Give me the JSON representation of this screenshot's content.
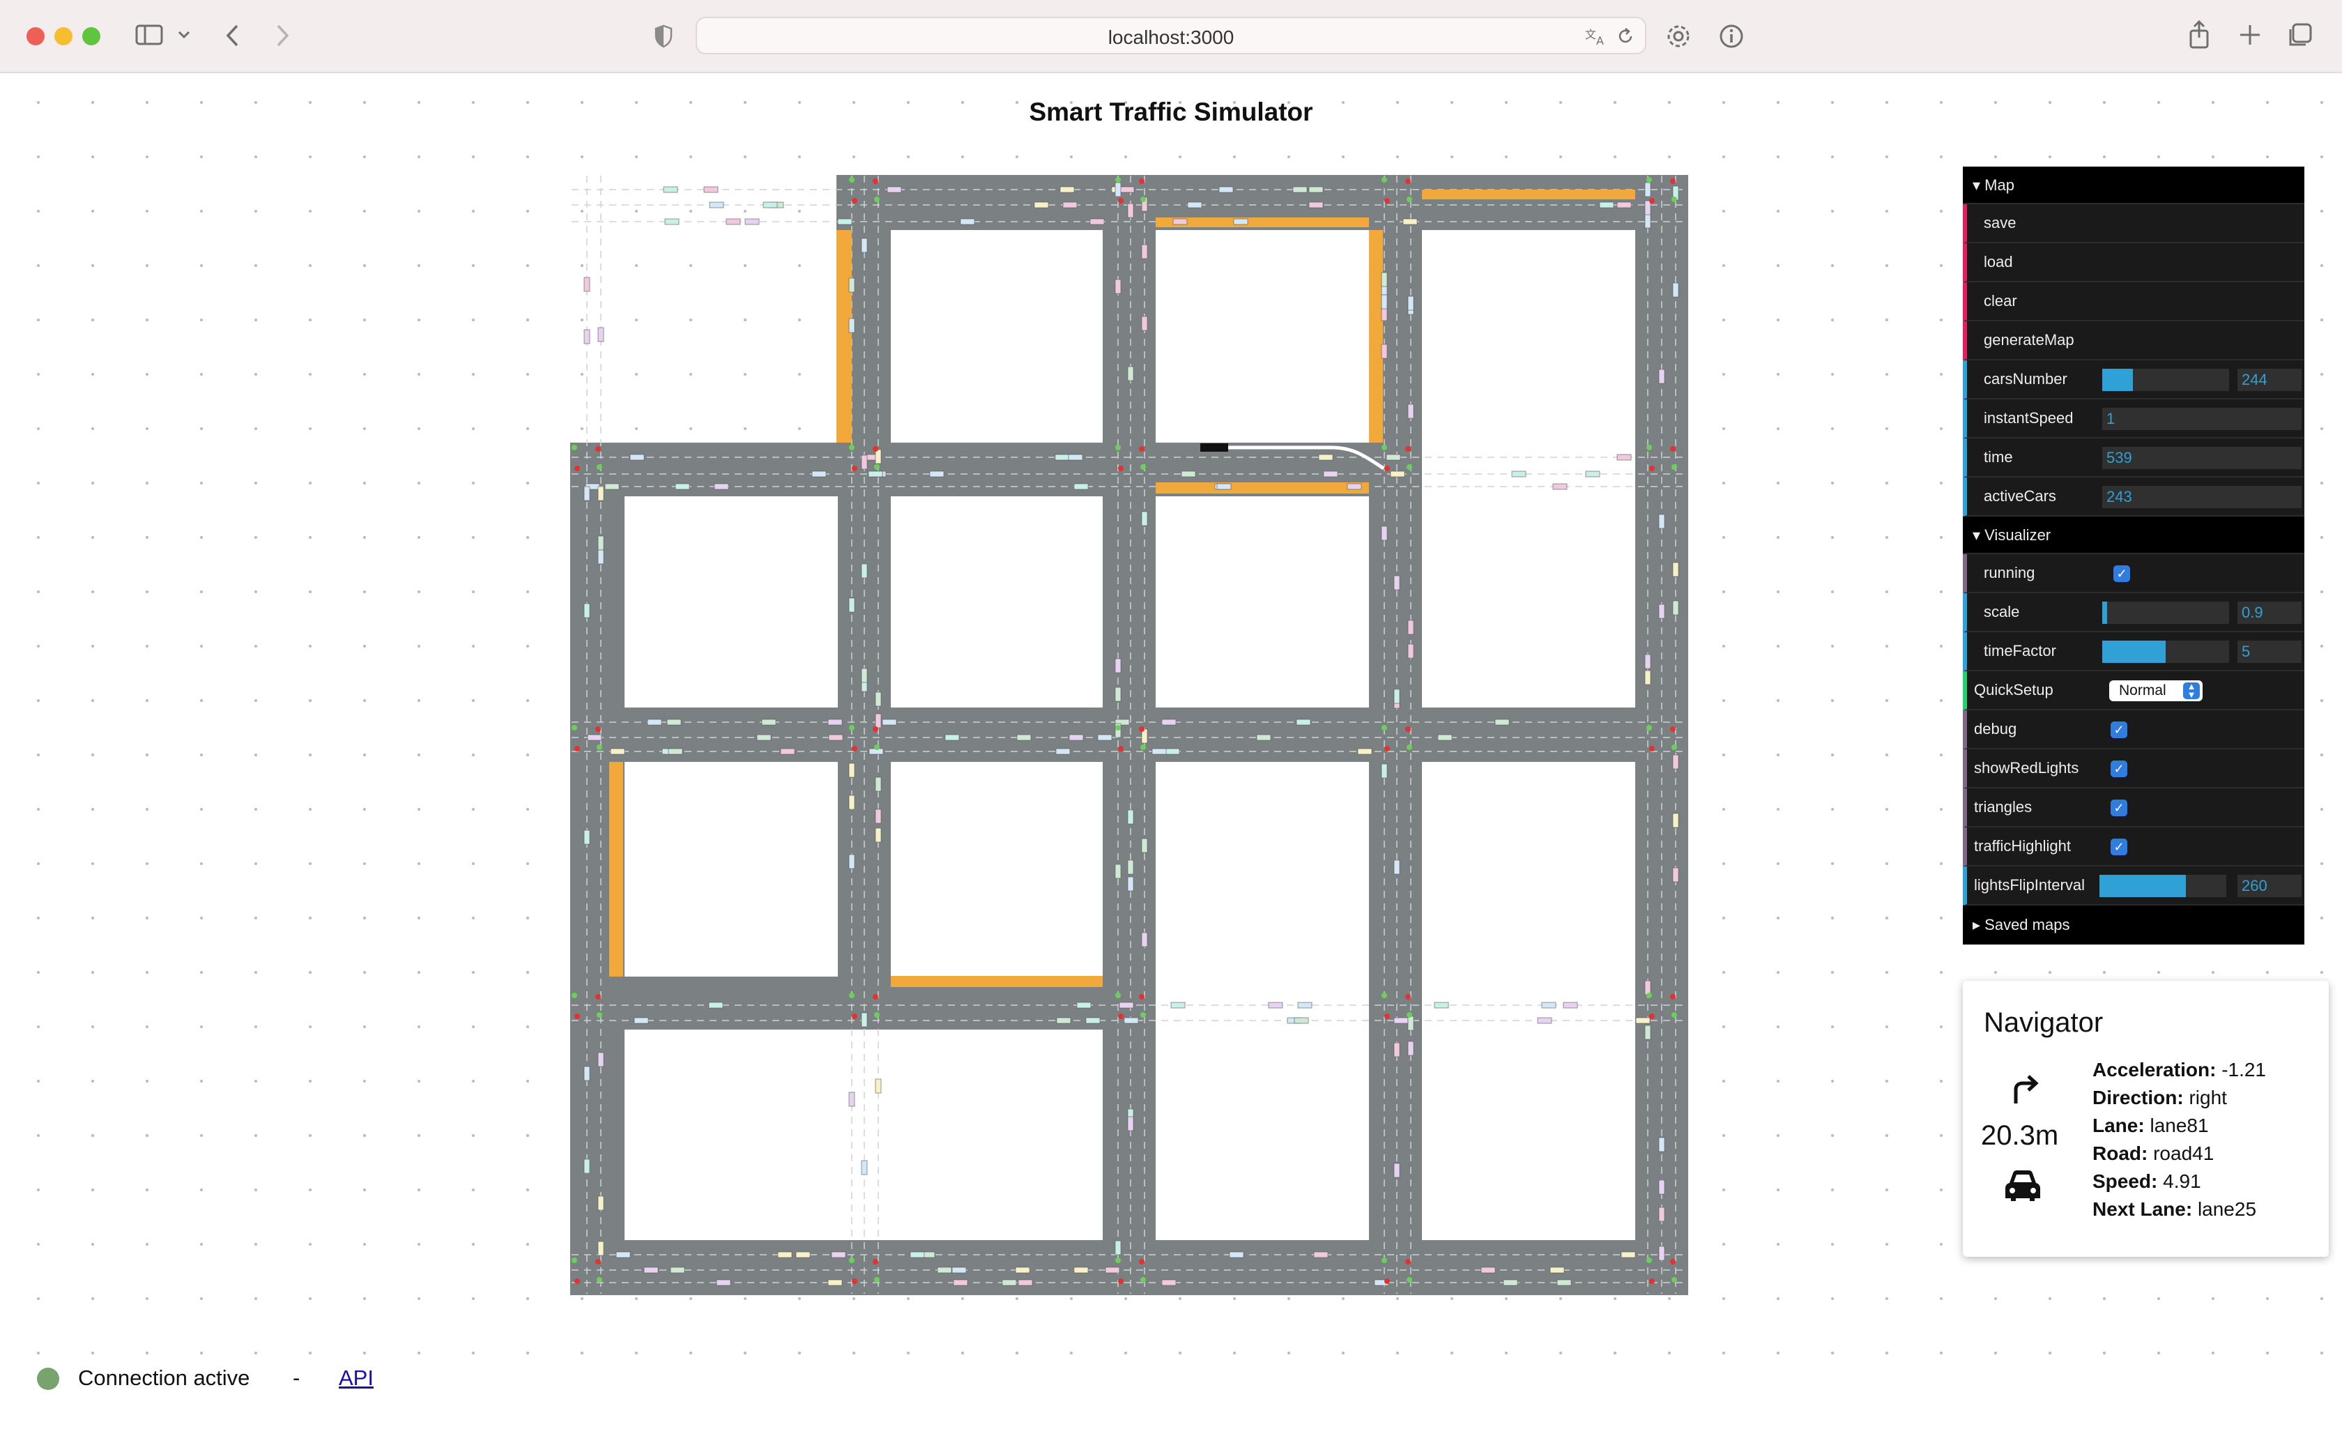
{
  "browser": {
    "url": "localhost:3000"
  },
  "page": {
    "title": "Smart Traffic Simulator"
  },
  "gui": {
    "map_folder": "Map",
    "save": "save",
    "load": "load",
    "clear": "clear",
    "generate": "generateMap",
    "cars_label": "carsNumber",
    "cars_value": "244",
    "cars_fill": 0.24,
    "instant_label": "instantSpeed",
    "instant_value": "1",
    "time_label": "time",
    "time_value": "539",
    "active_label": "activeCars",
    "active_value": "243",
    "visualizer_folder": "Visualizer",
    "running": "running",
    "scale_label": "scale",
    "scale_value": "0.9",
    "scale_fill": 0.04,
    "timefactor_label": "timeFactor",
    "timefactor_value": "5",
    "timefactor_fill": 0.5,
    "quicksetup_label": "QuickSetup",
    "quicksetup_value": "Normal",
    "debug": "debug",
    "showredlights": "showRedLights",
    "triangles": "triangles",
    "traffichighlight": "trafficHighlight",
    "lightsflip_label": "lightsFlipInterval",
    "lightsflip_value": "260",
    "lightsflip_fill": 0.68,
    "saved_maps": "Saved maps"
  },
  "navigator": {
    "title": "Navigator",
    "distance": "20.3m",
    "acceleration_label": "Acceleration:",
    "acceleration": "-1.21",
    "direction_label": "Direction:",
    "direction": "right",
    "lane_label": "Lane:",
    "lane": "lane81",
    "road_label": "Road:",
    "road": "road41",
    "speed_label": "Speed:",
    "speed": "4.91",
    "next_lane_label": "Next Lane:",
    "next_lane": "lane25"
  },
  "footer": {
    "status": "Connection active",
    "separator": "-",
    "api_link": "API"
  },
  "colors": {
    "road": "#7b8083",
    "congestion": "#f2a93b",
    "status_ok": "#77a36d",
    "gui_accent": "#2fa1d6"
  }
}
